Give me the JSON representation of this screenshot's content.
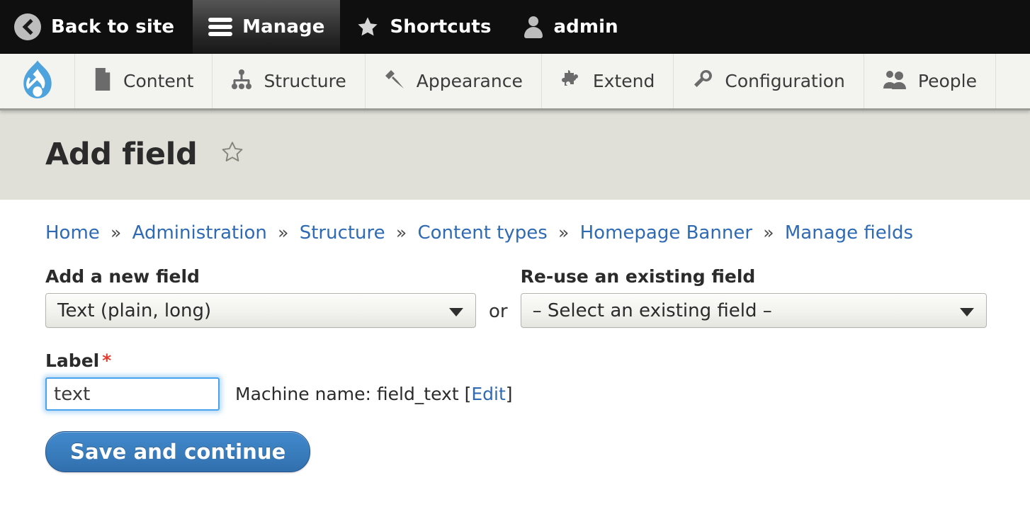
{
  "toolbar": {
    "items": [
      {
        "label": "Back to site",
        "icon": "back-circle-icon",
        "active": false
      },
      {
        "label": "Manage",
        "icon": "hamburger-icon",
        "active": true
      },
      {
        "label": "Shortcuts",
        "icon": "star-icon",
        "active": false
      },
      {
        "label": "admin",
        "icon": "user-icon",
        "active": false
      }
    ]
  },
  "tray": {
    "logo": "drupal-droplet-logo",
    "items": [
      {
        "label": "Content",
        "icon": "document-icon"
      },
      {
        "label": "Structure",
        "icon": "sitemap-icon"
      },
      {
        "label": "Appearance",
        "icon": "paintbrush-icon"
      },
      {
        "label": "Extend",
        "icon": "puzzle-piece-icon"
      },
      {
        "label": "Configuration",
        "icon": "wrench-icon"
      },
      {
        "label": "People",
        "icon": "people-icon"
      }
    ]
  },
  "page": {
    "title": "Add field",
    "star_icon": "star-outline-icon"
  },
  "breadcrumb": {
    "separator": "»",
    "items": [
      "Home",
      "Administration",
      "Structure",
      "Content types",
      "Homepage Banner",
      "Manage fields"
    ]
  },
  "form": {
    "new_field": {
      "label": "Add a new field",
      "value": "Text (plain, long)"
    },
    "or_label": "or",
    "reuse_field": {
      "label": "Re-use an existing field",
      "value": "– Select an existing field –"
    },
    "label_field": {
      "label": "Label",
      "required_marker": "*",
      "value": "text",
      "placeholder": ""
    },
    "machine_name": {
      "prefix": "Machine name: field_text [",
      "edit_link": "Edit",
      "suffix": "]"
    },
    "submit_label": "Save and continue"
  },
  "colors": {
    "toolbar_bg": "#0f0f0f",
    "tray_bg": "#f3f3ef",
    "header_band": "#e0e0d9",
    "link_blue": "#2f6ab4",
    "button_blue": "#3a7ebe",
    "required_red": "#e53b2e",
    "drupal_blue": "#4fa3dd",
    "focus_blue": "#4aa3ef"
  }
}
